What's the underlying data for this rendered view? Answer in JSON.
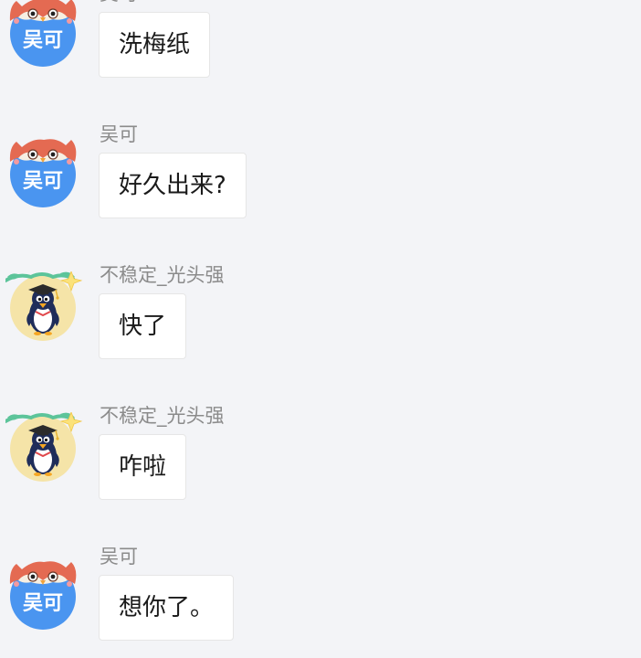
{
  "colors": {
    "background": "#f3f4f7",
    "bubble": "#ffffff",
    "bubble_border": "#e6e6e6",
    "sender_text": "#8b8b8b",
    "message_text": "#1a1a1a",
    "avatar_blue": "#4a95f0",
    "avatar_yellow": "#f5e4a8"
  },
  "messages": [
    {
      "sender": "吴可",
      "avatar_text": "吴可",
      "avatar_icon": "owl-mascot-icon",
      "text": "洗梅纸"
    },
    {
      "sender": "吴可",
      "avatar_text": "吴可",
      "avatar_icon": "owl-mascot-icon",
      "text": "好久出来?"
    },
    {
      "sender": "不稳定_光头强",
      "avatar_text": "",
      "avatar_icon": "penguin-graduate-icon",
      "text": "快了"
    },
    {
      "sender": "不稳定_光头强",
      "avatar_text": "",
      "avatar_icon": "penguin-graduate-icon",
      "text": "咋啦"
    },
    {
      "sender": "吴可",
      "avatar_text": "吴可",
      "avatar_icon": "owl-mascot-icon",
      "text": "想你了。"
    }
  ]
}
